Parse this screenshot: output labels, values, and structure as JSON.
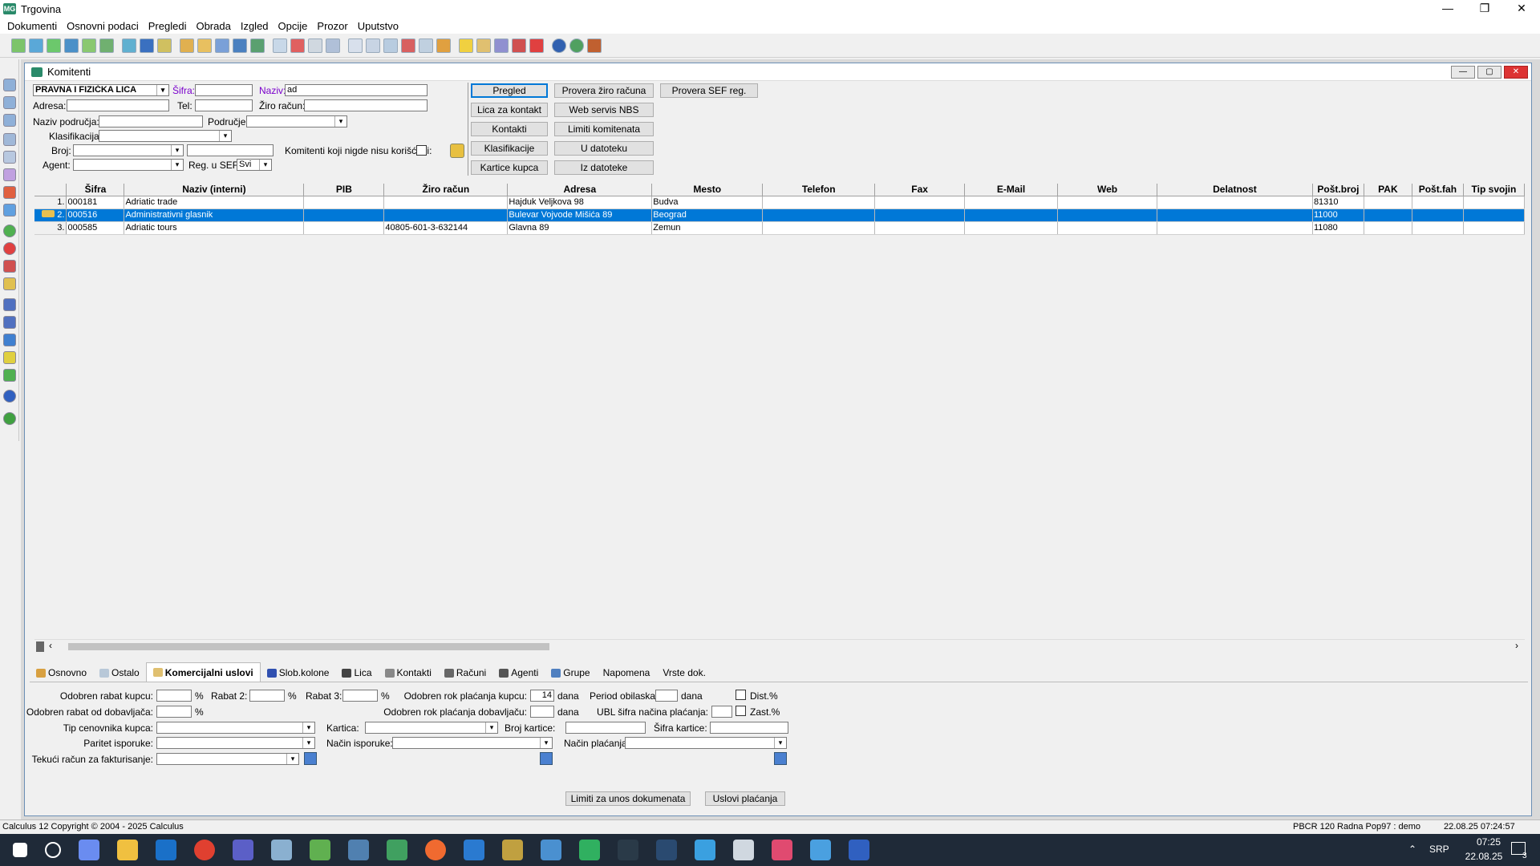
{
  "app": {
    "title": "Trgovina",
    "logo": "MG"
  },
  "menu": [
    "Dokumenti",
    "Osnovni podaci",
    "Pregledi",
    "Obrada",
    "Izgled",
    "Opcije",
    "Prozor",
    "Uputstvo"
  ],
  "window": {
    "title": "Komitenti"
  },
  "filter": {
    "type_value": "PRAVNA I FIZIČKA LICA",
    "sifra_label": "Šifra:",
    "sifra_value": "",
    "naziv_label": "Naziv:",
    "naziv_value": "ad",
    "adresa_label": "Adresa:",
    "tel_label": "Tel:",
    "ziro_label": "Žiro račun:",
    "naziv_podrucja_label": "Naziv područja:",
    "podrucje_label": "Područje:",
    "klasifikacija_label": "Klasifikacija:",
    "broj_label": "Broj:",
    "agent_label": "Agent:",
    "reg_sef_label": "Reg. u SEF:",
    "reg_sef_value": "Svi",
    "nisu_koristeni_label": "Komitenti koji nigde nisu korišćeni:"
  },
  "buttons": {
    "pregled": "Pregled",
    "provera_ziro": "Provera žiro računa",
    "provera_sef": "Provera SEF reg.",
    "lica_za_kontakt": "Lica za kontakt",
    "web_servis": "Web servis NBS",
    "kontakti": "Kontakti",
    "limiti_komitenta": "Limiti komitenata",
    "klasifikacije": "Klasifikacije",
    "u_datoteku": "U datoteku",
    "kartice_kupca": "Kartice kupca",
    "iz_datoteke": "Iz datoteke"
  },
  "table": {
    "columns": [
      "Šifra",
      "Naziv (interni)",
      "PIB",
      "Žiro račun",
      "Adresa",
      "Mesto",
      "Telefon",
      "Fax",
      "E-Mail",
      "Web",
      "Delatnost",
      "Pošt.broj",
      "PAK",
      "Pošt.fah",
      "Tip svojin"
    ],
    "rows": [
      {
        "rn": "1.",
        "sifra": "000181",
        "naziv": "Adriatic trade",
        "pib": "",
        "ziro": "",
        "adresa": "Hajduk Veljkova 98",
        "mesto": "Budva",
        "posta": "81310"
      },
      {
        "rn": "2.",
        "sifra": "000516",
        "naziv": "Administrativni glasnik",
        "pib": "",
        "ziro": "",
        "adresa": "Bulevar Vojvode Mišića 89",
        "mesto": "Beograd",
        "posta": "11000"
      },
      {
        "rn": "3.",
        "sifra": "000585",
        "naziv": "Adriatic tours",
        "pib": "",
        "ziro": "40805-601-3-632144",
        "adresa": "Glavna 89",
        "mesto": "Zemun",
        "posta": "11080"
      }
    ]
  },
  "tabs": [
    "Osnovno",
    "Ostalo",
    "Komercijalni uslovi",
    "Slob.kolone",
    "Lica",
    "Kontakti",
    "Računi",
    "Agenti",
    "Grupe",
    "Napomena",
    "Vrste dok."
  ],
  "commercial": {
    "rabat_kupcu": "Odobren rabat kupcu:",
    "rabat2": "Rabat 2:",
    "rabat3": "Rabat 3:",
    "pct": "%",
    "rok_kupcu": "Odobren rok plaćanja kupcu:",
    "rok_kupcu_value": "14",
    "dana": "dana",
    "period_obilaska": "Period obilaska:",
    "dist_pct": "Dist.%",
    "rabat_dobavljaca": "Odobren rabat od dobavljača:",
    "rok_dobavljacu": "Odobren rok plaćanja dobavljaču:",
    "ubl_sifra": "UBL šifra načina plaćanja:",
    "zast_pct": "Zast.%",
    "tip_cenovnika": "Tip cenovnika kupca:",
    "kartica": "Kartica:",
    "broj_kartice": "Broj kartice:",
    "sifra_kartice": "Šifra kartice:",
    "paritet": "Paritet isporuke:",
    "nacin_isporuke": "Način isporuke:",
    "nacin_placanja": "Način plaćanja:",
    "tekuci_racun": "Tekući račun za fakturisanje:",
    "limiti_btn": "Limiti za unos dokumenata",
    "uslovi_btn": "Uslovi plaćanja"
  },
  "status": {
    "left": "Calculus 12  Copyright © 2004 - 2025  Calculus",
    "mid": "PBCR 120 Radna Pop97 : demo",
    "right": "22.08.25 07:24:57"
  },
  "taskbar": {
    "lang": "SRP",
    "time": "07:25",
    "date": "22.08.25",
    "notif": "3"
  }
}
